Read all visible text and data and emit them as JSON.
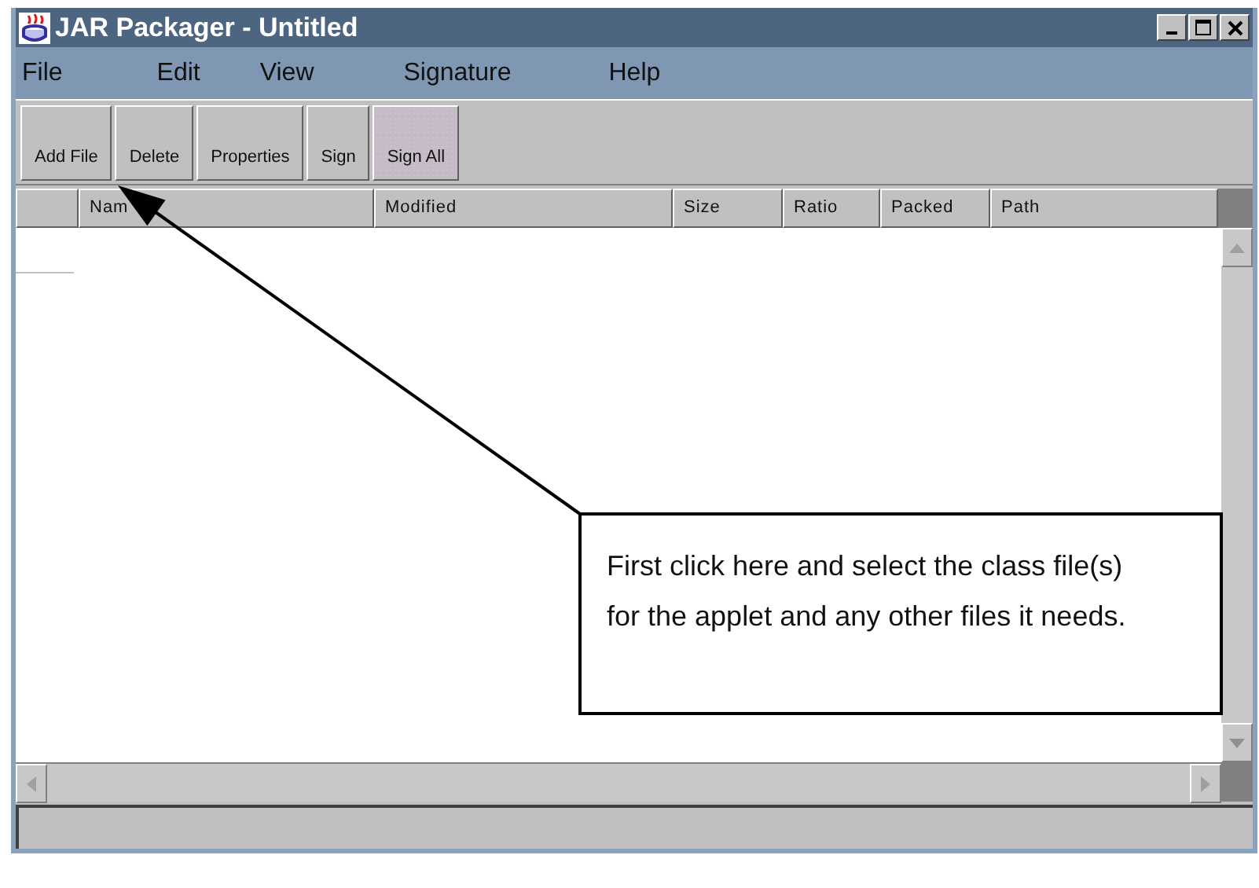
{
  "window": {
    "title": "JAR Packager - Untitled"
  },
  "menu": [
    "File",
    "Edit",
    "View",
    "Signature",
    "Help"
  ],
  "toolbar": [
    {
      "label": "Add File",
      "kind": "plain"
    },
    {
      "label": "Delete",
      "kind": "plain"
    },
    {
      "label": "Properties",
      "kind": "plain"
    },
    {
      "label": "Sign",
      "kind": "plain"
    },
    {
      "label": "Sign All",
      "kind": "dithered"
    }
  ],
  "table": {
    "columns": [
      "Nam",
      "Modified",
      "Size",
      "Ratio",
      "Packed",
      "Path"
    ]
  },
  "callout": {
    "text": "First click here and select the class file(s) for the applet and any other files it needs."
  }
}
